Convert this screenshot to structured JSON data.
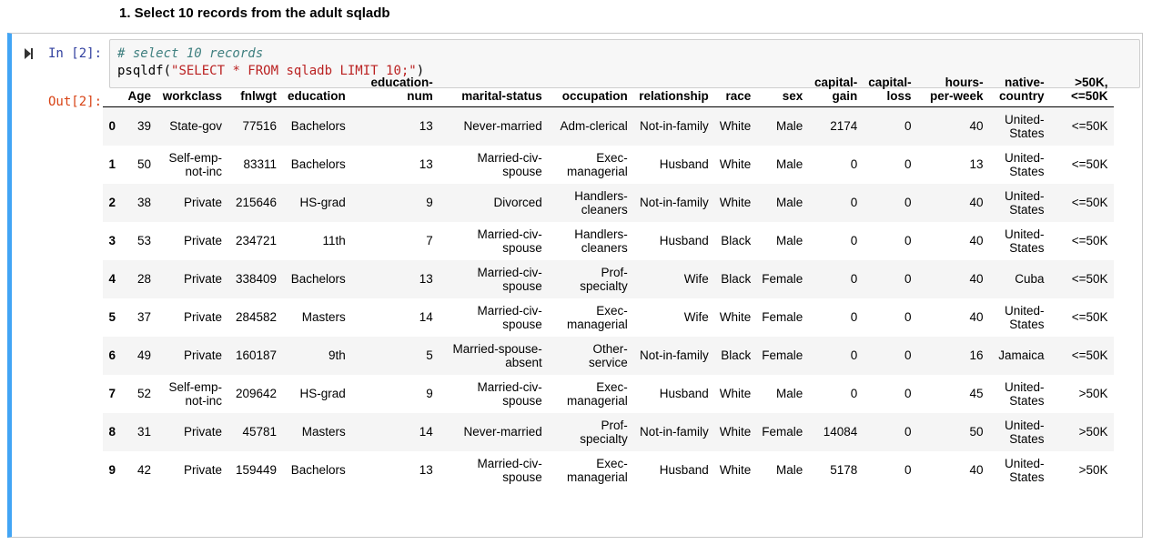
{
  "markdown": {
    "heading": "1. Select 10 records from the adult sqladb"
  },
  "cell": {
    "in_prompt": "In [2]:",
    "out_prompt": "Out[2]:",
    "code_comment": "# select 10 records",
    "code_fn": "psqldf(",
    "code_string": "\"SELECT * FROM sqladb LIMIT 10;\"",
    "code_close": ")"
  },
  "table": {
    "columns": [
      [
        ""
      ],
      [
        "Age"
      ],
      [
        "workclass"
      ],
      [
        "fnlwgt"
      ],
      [
        "education"
      ],
      [
        "education-",
        "num"
      ],
      [
        "marital-status"
      ],
      [
        "occupation"
      ],
      [
        "relationship"
      ],
      [
        "race"
      ],
      [
        "sex"
      ],
      [
        "capital-",
        "gain"
      ],
      [
        "capital-",
        "loss"
      ],
      [
        "hours-",
        "per-week"
      ],
      [
        "native-",
        "country"
      ],
      [
        ">50K,",
        "<=50K"
      ]
    ],
    "rows": [
      [
        "0",
        "39",
        [
          "State-gov"
        ],
        "77516",
        "Bachelors",
        "13",
        [
          "Never-married"
        ],
        [
          "Adm-clerical"
        ],
        "Not-in-family",
        "White",
        "Male",
        "2174",
        "0",
        "40",
        [
          "United-",
          "States"
        ],
        "<=50K"
      ],
      [
        "1",
        "50",
        [
          "Self-emp-",
          "not-inc"
        ],
        "83311",
        "Bachelors",
        "13",
        [
          "Married-civ-",
          "spouse"
        ],
        [
          "Exec-",
          "managerial"
        ],
        "Husband",
        "White",
        "Male",
        "0",
        "0",
        "13",
        [
          "United-",
          "States"
        ],
        "<=50K"
      ],
      [
        "2",
        "38",
        [
          "Private"
        ],
        "215646",
        "HS-grad",
        "9",
        [
          "Divorced"
        ],
        [
          "Handlers-",
          "cleaners"
        ],
        "Not-in-family",
        "White",
        "Male",
        "0",
        "0",
        "40",
        [
          "United-",
          "States"
        ],
        "<=50K"
      ],
      [
        "3",
        "53",
        [
          "Private"
        ],
        "234721",
        "11th",
        "7",
        [
          "Married-civ-",
          "spouse"
        ],
        [
          "Handlers-",
          "cleaners"
        ],
        "Husband",
        "Black",
        "Male",
        "0",
        "0",
        "40",
        [
          "United-",
          "States"
        ],
        "<=50K"
      ],
      [
        "4",
        "28",
        [
          "Private"
        ],
        "338409",
        "Bachelors",
        "13",
        [
          "Married-civ-",
          "spouse"
        ],
        [
          "Prof-",
          "specialty"
        ],
        "Wife",
        "Black",
        "Female",
        "0",
        "0",
        "40",
        [
          "Cuba"
        ],
        "<=50K"
      ],
      [
        "5",
        "37",
        [
          "Private"
        ],
        "284582",
        "Masters",
        "14",
        [
          "Married-civ-",
          "spouse"
        ],
        [
          "Exec-",
          "managerial"
        ],
        "Wife",
        "White",
        "Female",
        "0",
        "0",
        "40",
        [
          "United-",
          "States"
        ],
        "<=50K"
      ],
      [
        "6",
        "49",
        [
          "Private"
        ],
        "160187",
        "9th",
        "5",
        [
          "Married-spouse-",
          "absent"
        ],
        [
          "Other-",
          "service"
        ],
        "Not-in-family",
        "Black",
        "Female",
        "0",
        "0",
        "16",
        [
          "Jamaica"
        ],
        "<=50K"
      ],
      [
        "7",
        "52",
        [
          "Self-emp-",
          "not-inc"
        ],
        "209642",
        "HS-grad",
        "9",
        [
          "Married-civ-",
          "spouse"
        ],
        [
          "Exec-",
          "managerial"
        ],
        "Husband",
        "White",
        "Male",
        "0",
        "0",
        "45",
        [
          "United-",
          "States"
        ],
        ">50K"
      ],
      [
        "8",
        "31",
        [
          "Private"
        ],
        "45781",
        "Masters",
        "14",
        [
          "Never-married"
        ],
        [
          "Prof-",
          "specialty"
        ],
        "Not-in-family",
        "White",
        "Female",
        "14084",
        "0",
        "50",
        [
          "United-",
          "States"
        ],
        ">50K"
      ],
      [
        "9",
        "42",
        [
          "Private"
        ],
        "159449",
        "Bachelors",
        "13",
        [
          "Married-civ-",
          "spouse"
        ],
        [
          "Exec-",
          "managerial"
        ],
        "Husband",
        "White",
        "Male",
        "5178",
        "0",
        "40",
        [
          "United-",
          "States"
        ],
        ">50K"
      ]
    ]
  },
  "colors": {
    "cell_accent": "#42a5f5",
    "in_prompt": "#303f9f",
    "out_prompt": "#d84315",
    "code_comment": "#408080",
    "code_string": "#ba2121"
  }
}
